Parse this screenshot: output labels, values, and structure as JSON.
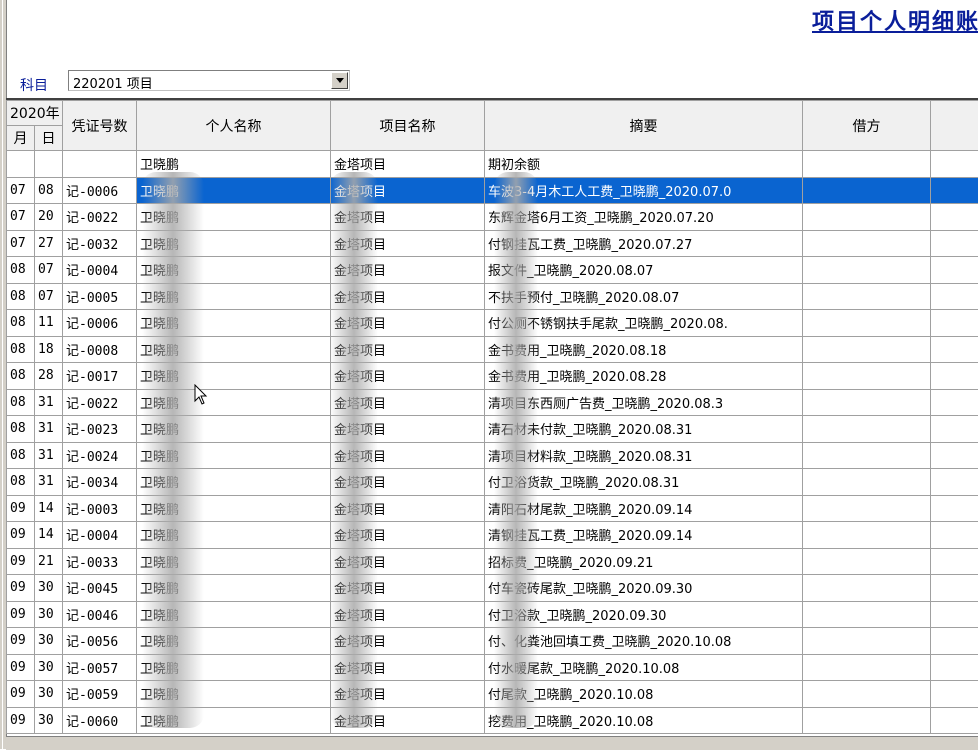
{
  "report_title": "项目个人明细账",
  "subject": {
    "label": "科目",
    "value": "220201 项目"
  },
  "columns": {
    "year": "2020年",
    "month": "月",
    "day": "日",
    "voucher": "凭证号数",
    "person": "个人名称",
    "project": "项目名称",
    "summary": "摘要",
    "debit": "借方"
  },
  "opening_row": {
    "person": "卫晓鹏",
    "project": "金塔项目",
    "summary": "期初余额"
  },
  "rows": [
    {
      "m": "07",
      "d": "08",
      "v": "记-0006",
      "person": "卫晓鹏",
      "project": "金塔项目",
      "summary": "车波3-4月木工人工费_卫晓鹏_2020.07.0"
    },
    {
      "m": "07",
      "d": "20",
      "v": "记-0022",
      "person": "卫晓鹏",
      "project": "金塔项目",
      "summary": "东辉金塔6月工资_卫晓鹏_2020.07.20"
    },
    {
      "m": "07",
      "d": "27",
      "v": "记-0032",
      "person": "卫晓鹏",
      "project": "金塔项目",
      "summary": "付钢挂瓦工费_卫晓鹏_2020.07.27"
    },
    {
      "m": "08",
      "d": "07",
      "v": "记-0004",
      "person": "卫晓鹏",
      "project": "金塔项目",
      "summary": "报文件_卫晓鹏_2020.08.07"
    },
    {
      "m": "08",
      "d": "07",
      "v": "记-0005",
      "person": "卫晓鹏",
      "project": "金塔项目",
      "summary": "不扶手预付_卫晓鹏_2020.08.07"
    },
    {
      "m": "08",
      "d": "11",
      "v": "记-0006",
      "person": "卫晓鹏",
      "project": "金塔项目",
      "summary": "付公厕不锈钢扶手尾款_卫晓鹏_2020.08."
    },
    {
      "m": "08",
      "d": "18",
      "v": "记-0008",
      "person": "卫晓鹏",
      "project": "金塔项目",
      "summary": "金书费用_卫晓鹏_2020.08.18"
    },
    {
      "m": "08",
      "d": "28",
      "v": "记-0017",
      "person": "卫晓鹏",
      "project": "金塔项目",
      "summary": "金书费用_卫晓鹏_2020.08.28"
    },
    {
      "m": "08",
      "d": "31",
      "v": "记-0022",
      "person": "卫晓鹏",
      "project": "金塔项目",
      "summary": "清项目东西厕广告费_卫晓鹏_2020.08.3"
    },
    {
      "m": "08",
      "d": "31",
      "v": "记-0023",
      "person": "卫晓鹏",
      "project": "金塔项目",
      "summary": "清石材未付款_卫晓鹏_2020.08.31"
    },
    {
      "m": "08",
      "d": "31",
      "v": "记-0024",
      "person": "卫晓鹏",
      "project": "金塔项目",
      "summary": "清项目材料款_卫晓鹏_2020.08.31"
    },
    {
      "m": "08",
      "d": "31",
      "v": "记-0034",
      "person": "卫晓鹏",
      "project": "金塔项目",
      "summary": "付卫浴货款_卫晓鹏_2020.08.31"
    },
    {
      "m": "09",
      "d": "14",
      "v": "记-0003",
      "person": "卫晓鹏",
      "project": "金塔项目",
      "summary": "清阳石材尾款_卫晓鹏_2020.09.14"
    },
    {
      "m": "09",
      "d": "14",
      "v": "记-0004",
      "person": "卫晓鹏",
      "project": "金塔项目",
      "summary": "清钢挂瓦工费_卫晓鹏_2020.09.14"
    },
    {
      "m": "09",
      "d": "21",
      "v": "记-0033",
      "person": "卫晓鹏",
      "project": "金塔项目",
      "summary": "招标费_卫晓鹏_2020.09.21"
    },
    {
      "m": "09",
      "d": "30",
      "v": "记-0045",
      "person": "卫晓鹏",
      "project": "金塔项目",
      "summary": "付车瓷砖尾款_卫晓鹏_2020.09.30"
    },
    {
      "m": "09",
      "d": "30",
      "v": "记-0046",
      "person": "卫晓鹏",
      "project": "金塔项目",
      "summary": "付卫浴款_卫晓鹏_2020.09.30"
    },
    {
      "m": "09",
      "d": "30",
      "v": "记-0056",
      "person": "卫晓鹏",
      "project": "金塔项目",
      "summary": "付、化粪池回填工费_卫晓鹏_2020.10.08"
    },
    {
      "m": "09",
      "d": "30",
      "v": "记-0057",
      "person": "卫晓鹏",
      "project": "金塔项目",
      "summary": "付水暖尾款_卫晓鹏_2020.10.08"
    },
    {
      "m": "09",
      "d": "30",
      "v": "记-0059",
      "person": "卫晓鹏",
      "project": "金塔项目",
      "summary": "付尾款_卫晓鹏_2020.10.08"
    },
    {
      "m": "09",
      "d": "30",
      "v": "记-0060",
      "person": "卫晓鹏",
      "project": "金塔项目",
      "summary": "挖费用_卫晓鹏_2020.10.08"
    }
  ]
}
